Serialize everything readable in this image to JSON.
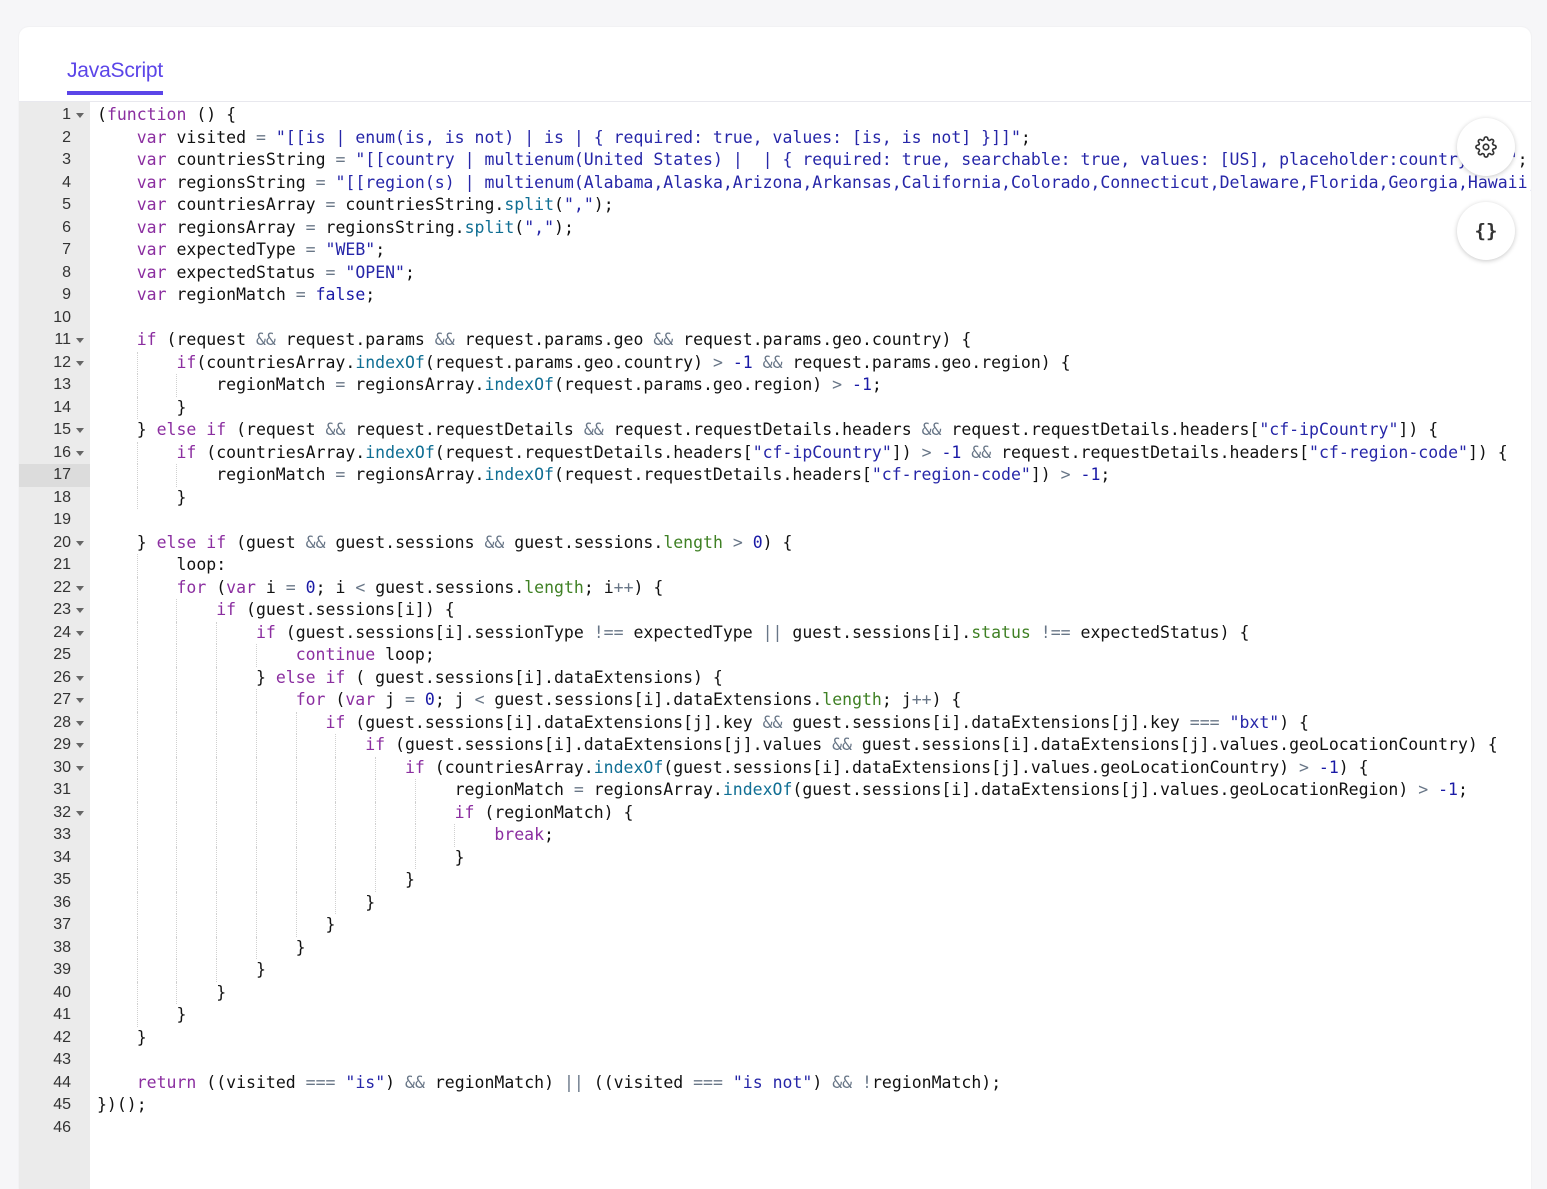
{
  "tab": {
    "label": "JavaScript"
  },
  "toolbar": {
    "settings_icon": "gear-icon",
    "format_icon": "braces-icon",
    "format_label": "{}"
  },
  "editor": {
    "active_line": 17,
    "fold_lines": [
      1,
      11,
      12,
      15,
      16,
      20,
      22,
      23,
      24,
      26,
      27,
      28,
      29,
      30,
      32
    ],
    "lines": [
      "(function () {",
      "    var visited = \"[[is | enum(is, is not) | is | { required: true, values: [is, is not] }]]\";",
      "    var countriesString = \"[[country | multienum(United States) |  | { required: true, searchable: true, values: [US], placeholder:country }]]\";",
      "    var regionsString = \"[[region(s) | multienum(Alabama,Alaska,Arizona,Arkansas,California,Colorado,Connecticut,Delaware,Florida,Georgia,Hawaii,",
      "    var countriesArray = countriesString.split(\",\");",
      "    var regionsArray = regionsString.split(\",\");",
      "    var expectedType = \"WEB\";",
      "    var expectedStatus = \"OPEN\";",
      "    var regionMatch = false;",
      "",
      "    if (request && request.params && request.params.geo && request.params.geo.country) {",
      "        if(countriesArray.indexOf(request.params.geo.country) > -1 && request.params.geo.region) {",
      "            regionMatch = regionsArray.indexOf(request.params.geo.region) > -1;",
      "        }",
      "    } else if (request && request.requestDetails && request.requestDetails.headers && request.requestDetails.headers[\"cf-ipCountry\"]) {",
      "        if (countriesArray.indexOf(request.requestDetails.headers[\"cf-ipCountry\"]) > -1 && request.requestDetails.headers[\"cf-region-code\"]) {",
      "            regionMatch = regionsArray.indexOf(request.requestDetails.headers[\"cf-region-code\"]) > -1;",
      "        }",
      "",
      "    } else if (guest && guest.sessions && guest.sessions.length > 0) {",
      "        loop:",
      "        for (var i = 0; i < guest.sessions.length; i++) {",
      "            if (guest.sessions[i]) {",
      "                if (guest.sessions[i].sessionType !== expectedType || guest.sessions[i].status !== expectedStatus) {",
      "                    continue loop;",
      "                } else if ( guest.sessions[i].dataExtensions) {",
      "                    for (var j = 0; j < guest.sessions[i].dataExtensions.length; j++) {",
      "                       if (guest.sessions[i].dataExtensions[j].key && guest.sessions[i].dataExtensions[j].key === \"bxt\") {",
      "                           if (guest.sessions[i].dataExtensions[j].values && guest.sessions[i].dataExtensions[j].values.geoLocationCountry) {",
      "                               if (countriesArray.indexOf(guest.sessions[i].dataExtensions[j].values.geoLocationCountry) > -1) {",
      "                                    regionMatch = regionsArray.indexOf(guest.sessions[i].dataExtensions[j].values.geoLocationRegion) > -1;",
      "                                    if (regionMatch) {",
      "                                        break;",
      "                                    }",
      "                               }",
      "                           }",
      "                       }",
      "                    }",
      "                }",
      "            }",
      "        }",
      "    }",
      "",
      "    return ((visited === \"is\") && regionMatch) || ((visited === \"is not\") && !regionMatch);",
      "})();",
      ""
    ]
  }
}
